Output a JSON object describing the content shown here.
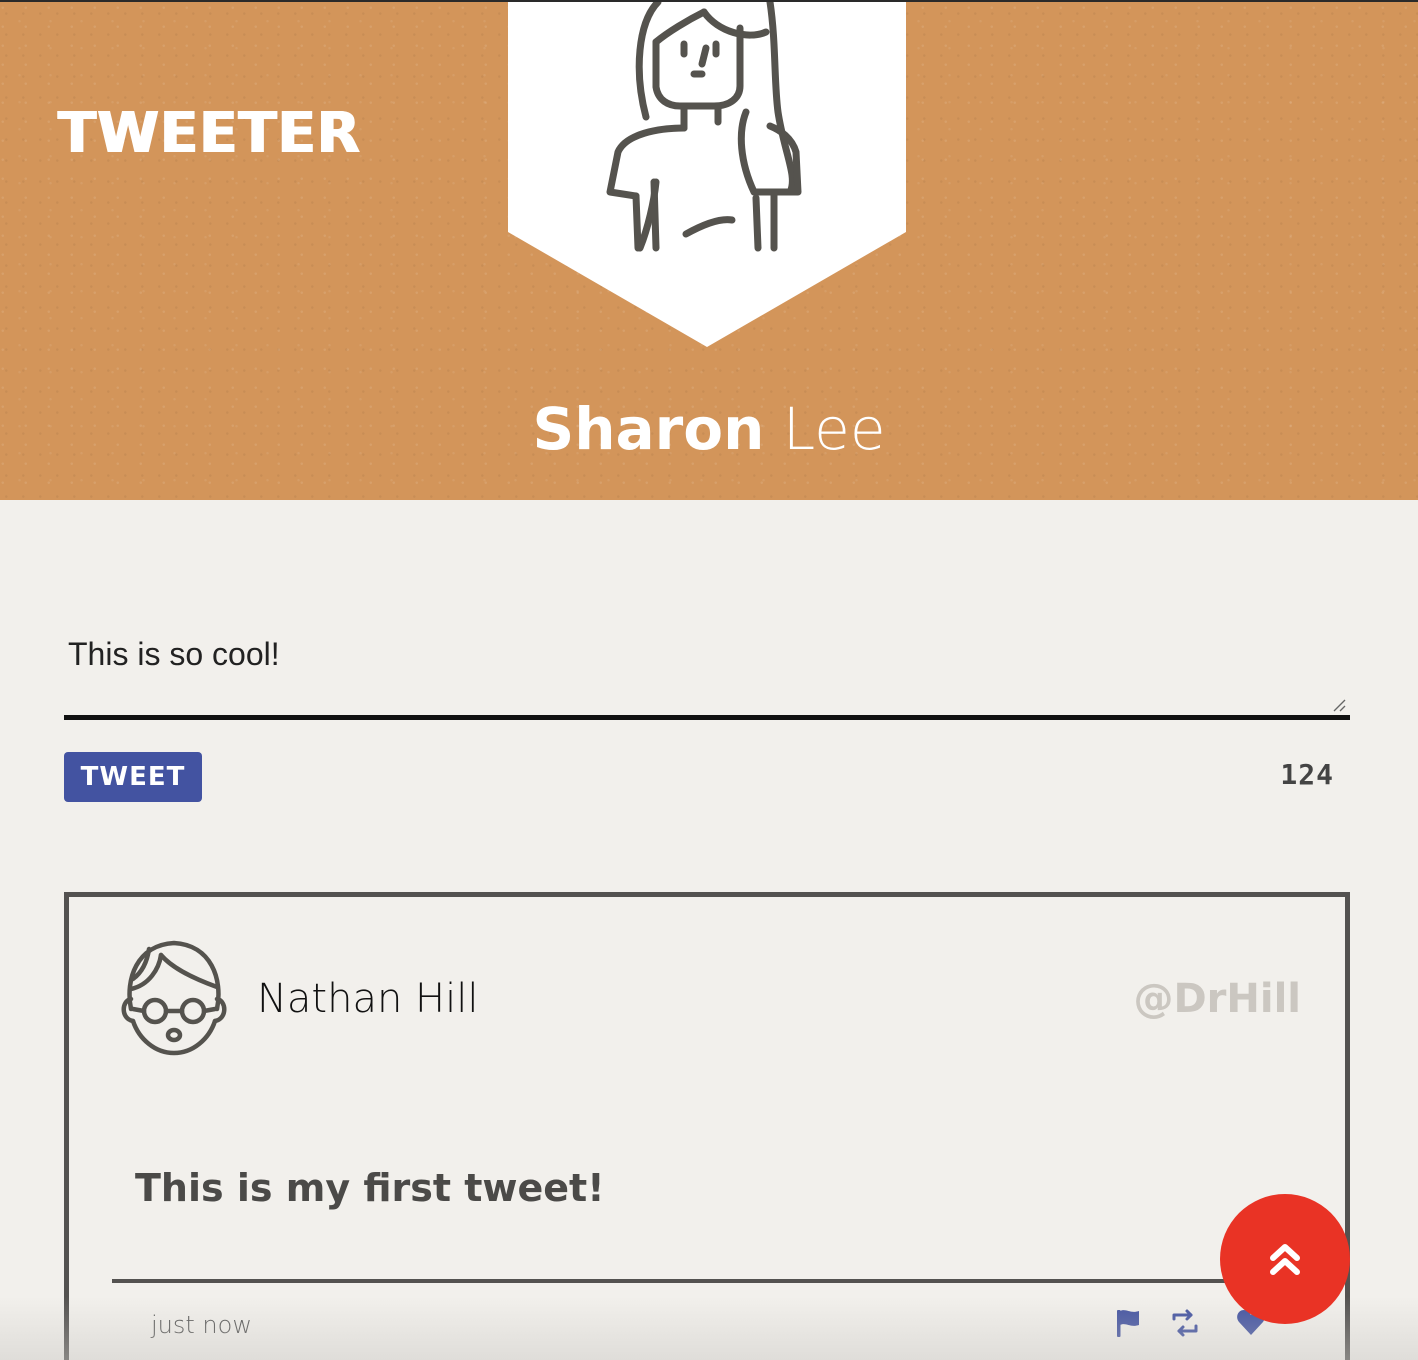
{
  "app": {
    "brand": "TWEETER"
  },
  "header": {
    "profile_first_name": "Sharon",
    "profile_last_name": "Lee",
    "background_color": "#d3955a",
    "banner_icon": "woman-avatar-icon"
  },
  "compose": {
    "text_value": "This is so cool!",
    "tweet_button_label": "TWEET",
    "char_count": "124",
    "button_color": "#4353a1"
  },
  "tweets": [
    {
      "author": "Nathan Hill",
      "handle": "@DrHill",
      "text": "This is my first tweet!",
      "time": "just now",
      "avatar_icon": "man-glasses-avatar-icon",
      "actions": [
        "flag-icon",
        "retweet-icon",
        "heart-icon"
      ],
      "action_color": "#4353a1"
    }
  ],
  "scroll_top": {
    "icon": "double-chevron-up-icon",
    "color": "#e93325"
  }
}
